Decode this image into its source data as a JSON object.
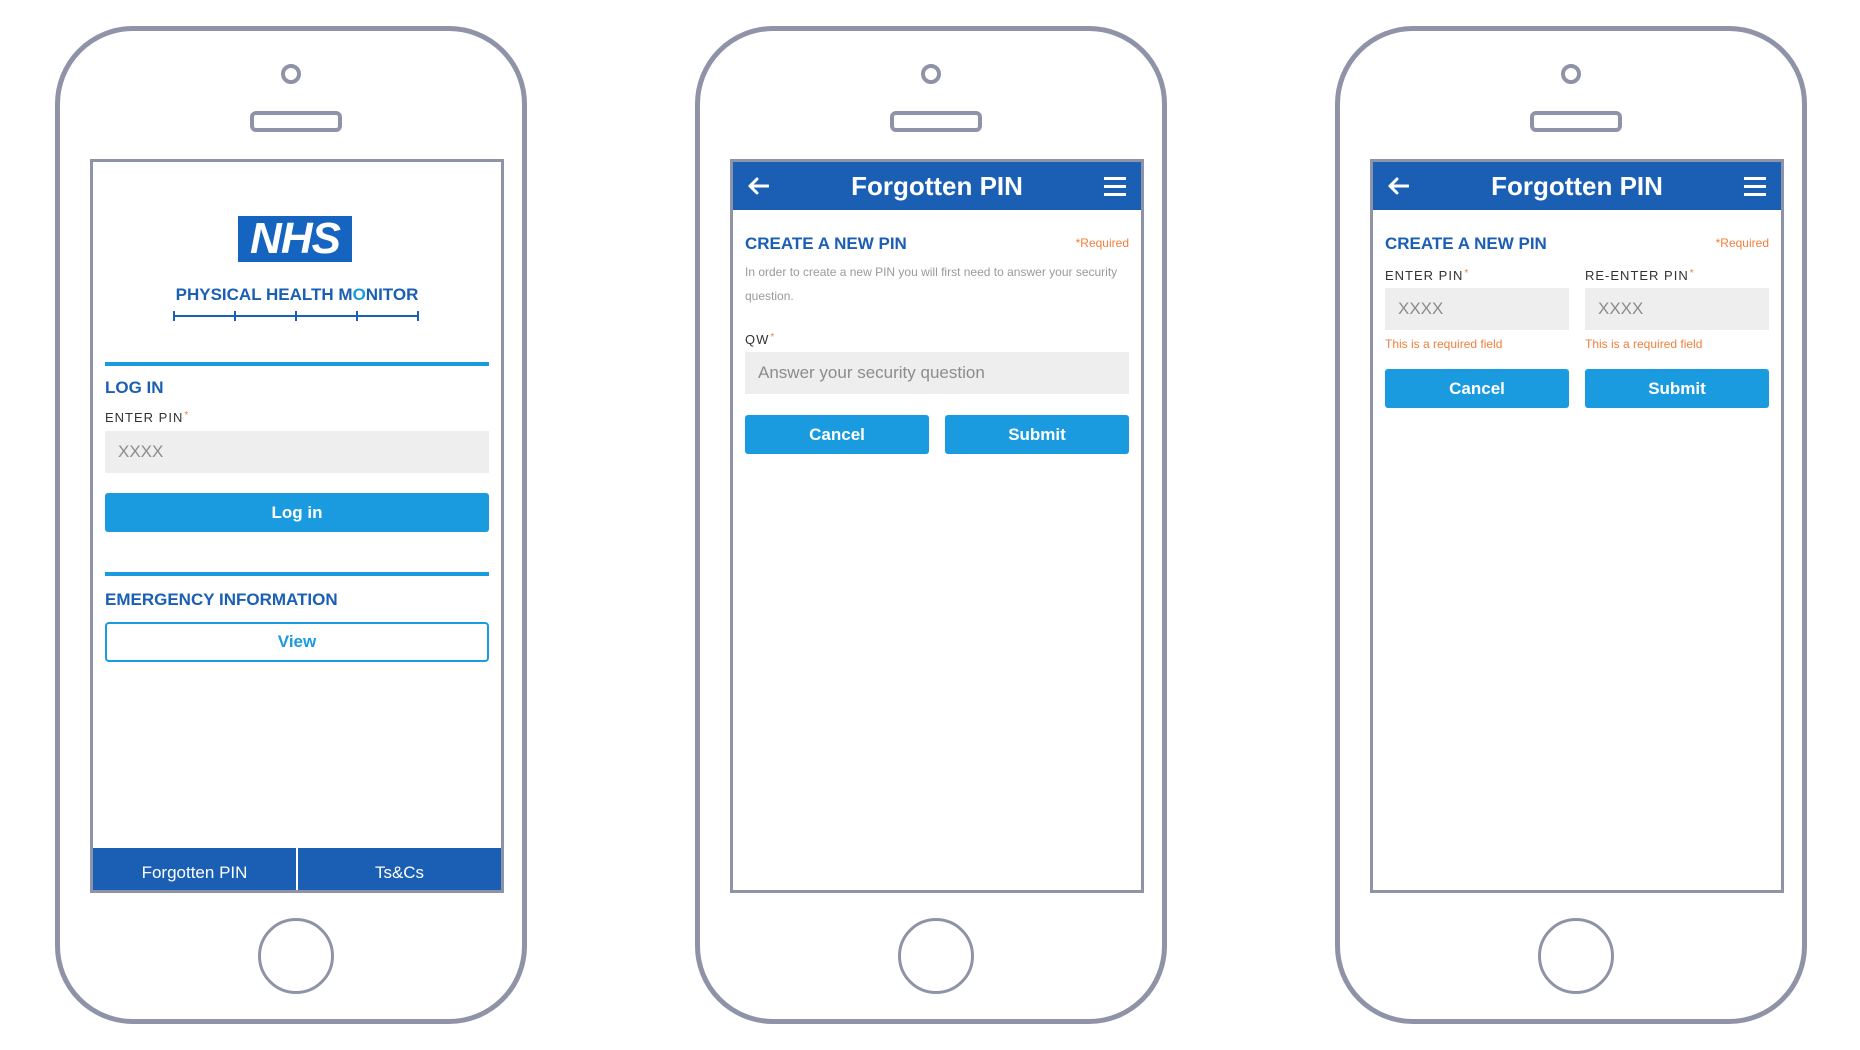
{
  "login": {
    "logo_text": "NHS",
    "app_name_part1": "PHYSICAL HEALTH M",
    "app_name_part2": "O",
    "app_name_part3": "NITOR",
    "login_title": "LOG IN",
    "pin_label": "ENTER PIN",
    "required_marker": "*",
    "pin_placeholder": "XXXX",
    "login_button": "Log in",
    "emergency_title": "EMERGENCY INFORMATION",
    "view_button": "View",
    "bottom_tabs": [
      "Forgotten PIN",
      "Ts&Cs"
    ]
  },
  "security": {
    "header_title": "Forgotten PIN",
    "section_title": "CREATE A NEW PIN",
    "required_note": "*Required",
    "help_text": "In order to create a new PIN you will first need to answer your security question.",
    "question_label": "QW",
    "required_marker": "*",
    "answer_placeholder": "Answer your security question",
    "cancel_button": "Cancel",
    "submit_button": "Submit"
  },
  "new_pin": {
    "header_title": "Forgotten PIN",
    "section_title": "CREATE A NEW PIN",
    "required_note": "*Required",
    "enter_pin_label": "ENTER PIN",
    "reenter_pin_label": "RE-ENTER PIN",
    "required_marker": "*",
    "pin_placeholder": "XXXX",
    "reenter_placeholder": "XXXX",
    "enter_error": "This is a required field",
    "reenter_error": "This is a required field",
    "cancel_button": "Cancel",
    "submit_button": "Submit"
  },
  "colors": {
    "nhs_blue": "#1a5fb4",
    "button_blue": "#1a9be0",
    "required_orange": "#f07f3c",
    "phone_outline": "#8e93a8"
  },
  "icons": [
    "back-arrow-icon",
    "hamburger-menu-icon"
  ]
}
